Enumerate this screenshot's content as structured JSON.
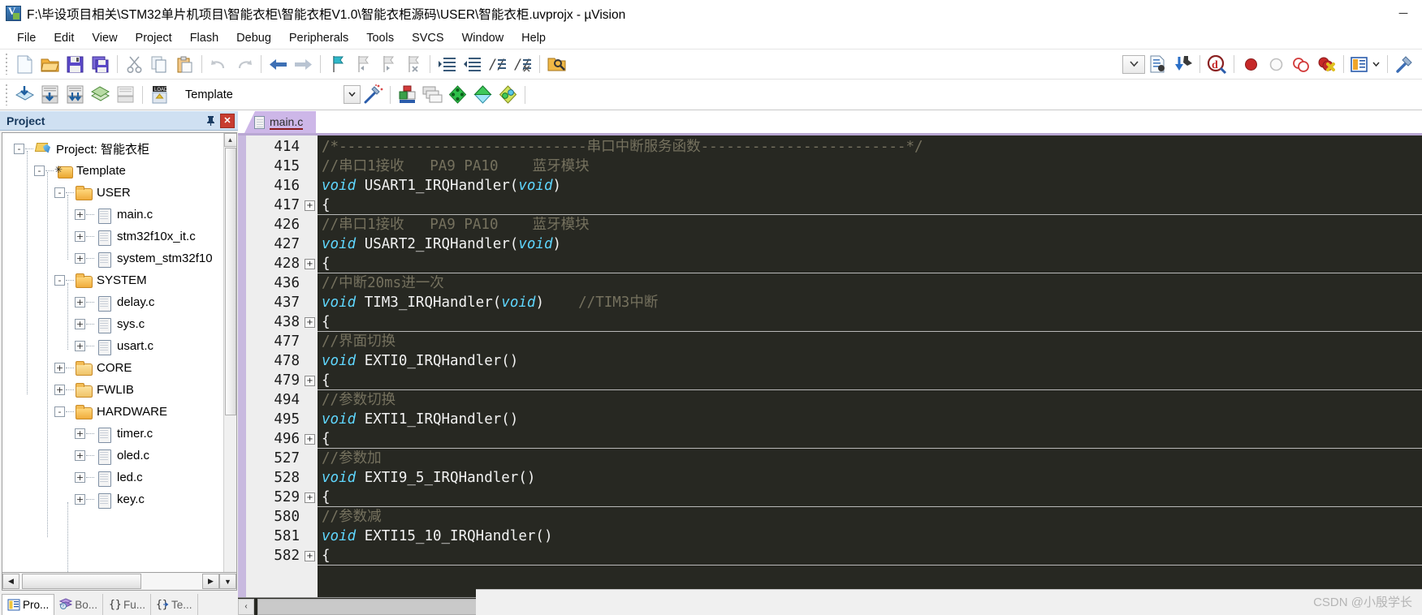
{
  "window": {
    "title": "F:\\毕设项目相关\\STM32单片机项目\\智能衣柜\\智能衣柜V1.0\\智能衣柜源码\\USER\\智能衣柜.uvprojx - µVision",
    "app_icon": "uvision-logo-icon",
    "minimize": "─",
    "maximize": "☐",
    "close": "✕"
  },
  "menu": {
    "items": [
      {
        "label": "File"
      },
      {
        "label": "Edit"
      },
      {
        "label": "View"
      },
      {
        "label": "Project"
      },
      {
        "label": "Flash"
      },
      {
        "label": "Debug"
      },
      {
        "label": "Peripherals"
      },
      {
        "label": "Tools"
      },
      {
        "label": "SVCS"
      },
      {
        "label": "Window"
      },
      {
        "label": "Help"
      }
    ]
  },
  "toolbar_main": {
    "buttons": [
      {
        "name": "new-file-icon"
      },
      {
        "name": "open-file-icon"
      },
      {
        "name": "save-icon"
      },
      {
        "name": "save-all-icon"
      },
      {
        "name": "cut-icon"
      },
      {
        "name": "copy-icon"
      },
      {
        "name": "paste-icon"
      },
      {
        "name": "undo-icon"
      },
      {
        "name": "redo-icon"
      },
      {
        "name": "navigate-back-icon"
      },
      {
        "name": "navigate-forward-icon"
      },
      {
        "name": "bookmark-toggle-icon"
      },
      {
        "name": "bookmark-prev-icon"
      },
      {
        "name": "bookmark-next-icon"
      },
      {
        "name": "bookmark-clear-icon"
      },
      {
        "name": "indent-increase-icon"
      },
      {
        "name": "indent-decrease-icon"
      },
      {
        "name": "comment-lines-icon"
      },
      {
        "name": "uncomment-lines-icon"
      },
      {
        "name": "find-in-files-icon"
      }
    ],
    "right_buttons": [
      {
        "name": "search-scope-dropdown"
      },
      {
        "name": "insert-file-icon"
      },
      {
        "name": "configure-target-icon"
      },
      {
        "name": "start-debug-icon"
      },
      {
        "name": "insert-breakpoint-icon"
      },
      {
        "name": "disable-breakpoint-icon"
      },
      {
        "name": "disable-all-breakpoints-icon"
      },
      {
        "name": "kill-all-breakpoints-icon"
      },
      {
        "name": "window-layout-icon"
      },
      {
        "name": "window-layout-dropdown"
      },
      {
        "name": "configuration-wizard-icon"
      }
    ]
  },
  "toolbar_build": {
    "buttons": [
      {
        "name": "translate-icon"
      },
      {
        "name": "build-icon"
      },
      {
        "name": "rebuild-icon"
      },
      {
        "name": "batch-build-icon"
      },
      {
        "name": "stop-build-icon"
      },
      {
        "name": "download-to-flash-icon"
      }
    ],
    "target_value": "Template",
    "dropdown_arrow": "⌄",
    "right_buttons": [
      {
        "name": "target-options-wizard-icon"
      },
      {
        "name": "manage-project-items-icon"
      },
      {
        "name": "multi-project-icon"
      },
      {
        "name": "manage-components-green-icon"
      },
      {
        "name": "manage-run-time-env-icon"
      },
      {
        "name": "pack-installer-icon"
      }
    ]
  },
  "project_panel": {
    "title": "Project",
    "pin_icon": "pin-icon",
    "close_icon": "close-icon",
    "tree": [
      {
        "level": 0,
        "node": "-",
        "icon": "project-icon",
        "label": "Project: 智能衣柜"
      },
      {
        "level": 1,
        "node": "-",
        "icon": "target-icon",
        "label": "Template"
      },
      {
        "level": 2,
        "node": "-",
        "icon": "folder-open-icon",
        "label": "USER"
      },
      {
        "level": 3,
        "node": "+",
        "icon": "c-file-icon",
        "label": "main.c"
      },
      {
        "level": 3,
        "node": "+",
        "icon": "c-file-icon",
        "label": "stm32f10x_it.c"
      },
      {
        "level": 3,
        "node": "+",
        "icon": "c-file-icon",
        "label": "system_stm32f10"
      },
      {
        "level": 2,
        "node": "-",
        "icon": "folder-open-icon",
        "label": "SYSTEM"
      },
      {
        "level": 3,
        "node": "+",
        "icon": "c-file-icon",
        "label": "delay.c"
      },
      {
        "level": 3,
        "node": "+",
        "icon": "c-file-icon",
        "label": "sys.c"
      },
      {
        "level": 3,
        "node": "+",
        "icon": "c-file-icon",
        "label": "usart.c"
      },
      {
        "level": 2,
        "node": "+",
        "icon": "folder-closed-icon",
        "label": "CORE"
      },
      {
        "level": 2,
        "node": "+",
        "icon": "folder-closed-icon",
        "label": "FWLIB"
      },
      {
        "level": 2,
        "node": "-",
        "icon": "folder-open-icon",
        "label": "HARDWARE"
      },
      {
        "level": 3,
        "node": "+",
        "icon": "c-file-icon",
        "label": "timer.c"
      },
      {
        "level": 3,
        "node": "+",
        "icon": "c-file-icon",
        "label": "oled.c"
      },
      {
        "level": 3,
        "node": "+",
        "icon": "c-file-icon",
        "label": "led.c"
      },
      {
        "level": 3,
        "node": "+",
        "icon": "c-file-icon",
        "label": "key.c"
      }
    ],
    "hscroll": {
      "left_arrow": "◀",
      "right_arrow": "▶",
      "down_arrow": "▼"
    },
    "tabs": [
      {
        "label": "Pro...",
        "icon": "project-tab-icon",
        "active": true
      },
      {
        "label": "Bo...",
        "icon": "books-tab-icon",
        "active": false
      },
      {
        "label": "Fu...",
        "icon": "functions-tab-icon",
        "active": false
      },
      {
        "label": "Te...",
        "icon": "templates-tab-icon",
        "active": false
      }
    ]
  },
  "editor": {
    "tab": {
      "label": "main.c",
      "icon": "c-file-icon"
    },
    "lines": [
      {
        "num": "414",
        "fold": "",
        "segments": [
          {
            "cls": "c-comment",
            "text": "/*-----------------------------串口中断服务函数------------------------*/"
          }
        ]
      },
      {
        "num": "415",
        "fold": "",
        "segments": [
          {
            "cls": "c-comment",
            "text": "//串口1接收   PA9 PA10    蓝牙模块"
          }
        ]
      },
      {
        "num": "416",
        "fold": "",
        "segments": [
          {
            "cls": "c-kw",
            "text": "void"
          },
          {
            "cls": "c-id",
            "text": " USART1_IRQHandler("
          },
          {
            "cls": "c-kw",
            "text": "void"
          },
          {
            "cls": "c-id",
            "text": ")"
          }
        ]
      },
      {
        "num": "417",
        "fold": "+",
        "folded": true,
        "segments": [
          {
            "cls": "c-punc",
            "text": "{"
          }
        ]
      },
      {
        "num": "426",
        "fold": "",
        "segments": [
          {
            "cls": "c-comment",
            "text": "//串口1接收   PA9 PA10    蓝牙模块"
          }
        ]
      },
      {
        "num": "427",
        "fold": "",
        "segments": [
          {
            "cls": "c-kw",
            "text": "void"
          },
          {
            "cls": "c-id",
            "text": " USART2_IRQHandler("
          },
          {
            "cls": "c-kw",
            "text": "void"
          },
          {
            "cls": "c-id",
            "text": ")"
          }
        ]
      },
      {
        "num": "428",
        "fold": "+",
        "folded": true,
        "segments": [
          {
            "cls": "c-punc",
            "text": "{"
          }
        ]
      },
      {
        "num": "436",
        "fold": "",
        "segments": [
          {
            "cls": "c-comment",
            "text": "//中断20ms进一次"
          }
        ]
      },
      {
        "num": "437",
        "fold": "",
        "segments": [
          {
            "cls": "c-kw",
            "text": "void"
          },
          {
            "cls": "c-id",
            "text": " TIM3_IRQHandler("
          },
          {
            "cls": "c-kw",
            "text": "void"
          },
          {
            "cls": "c-id",
            "text": ")"
          },
          {
            "cls": "c-comment",
            "text": "    //TIM3中断"
          }
        ]
      },
      {
        "num": "438",
        "fold": "+",
        "folded": true,
        "segments": [
          {
            "cls": "c-punc",
            "text": "{"
          }
        ]
      },
      {
        "num": "477",
        "fold": "",
        "segments": [
          {
            "cls": "c-comment",
            "text": "//界面切换"
          }
        ]
      },
      {
        "num": "478",
        "fold": "",
        "segments": [
          {
            "cls": "c-kw",
            "text": "void"
          },
          {
            "cls": "c-id",
            "text": " EXTI0_IRQHandler()"
          }
        ]
      },
      {
        "num": "479",
        "fold": "+",
        "folded": true,
        "segments": [
          {
            "cls": "c-punc",
            "text": "{"
          }
        ]
      },
      {
        "num": "494",
        "fold": "",
        "segments": [
          {
            "cls": "c-comment",
            "text": "//参数切换"
          }
        ]
      },
      {
        "num": "495",
        "fold": "",
        "segments": [
          {
            "cls": "c-kw",
            "text": "void"
          },
          {
            "cls": "c-id",
            "text": " EXTI1_IRQHandler()"
          }
        ]
      },
      {
        "num": "496",
        "fold": "+",
        "folded": true,
        "segments": [
          {
            "cls": "c-punc",
            "text": "{"
          }
        ]
      },
      {
        "num": "527",
        "fold": "",
        "segments": [
          {
            "cls": "c-comment",
            "text": "//参数加"
          }
        ]
      },
      {
        "num": "528",
        "fold": "",
        "segments": [
          {
            "cls": "c-kw",
            "text": "void"
          },
          {
            "cls": "c-id",
            "text": " EXTI9_5_IRQHandler()"
          }
        ]
      },
      {
        "num": "529",
        "fold": "+",
        "folded": true,
        "segments": [
          {
            "cls": "c-punc",
            "text": "{"
          }
        ]
      },
      {
        "num": "580",
        "fold": "",
        "segments": [
          {
            "cls": "c-comment",
            "text": "//参数减"
          }
        ]
      },
      {
        "num": "581",
        "fold": "",
        "segments": [
          {
            "cls": "c-kw",
            "text": "void"
          },
          {
            "cls": "c-id",
            "text": " EXTI15_10_IRQHandler()"
          }
        ]
      },
      {
        "num": "582",
        "fold": "+",
        "folded": true,
        "segments": [
          {
            "cls": "c-punc",
            "text": "{"
          }
        ]
      }
    ],
    "hscroll": {
      "left_arrow": "‹",
      "right_arrow": "›"
    }
  },
  "watermark": "CSDN @小殷学长",
  "colors": {
    "editor_bg": "#272822",
    "comment": "#75715e",
    "keyword": "#5fd7ff",
    "identifier": "#f2f2f2",
    "tab_active": "#cdb7e8",
    "panel_header": "#cfe0f2"
  }
}
